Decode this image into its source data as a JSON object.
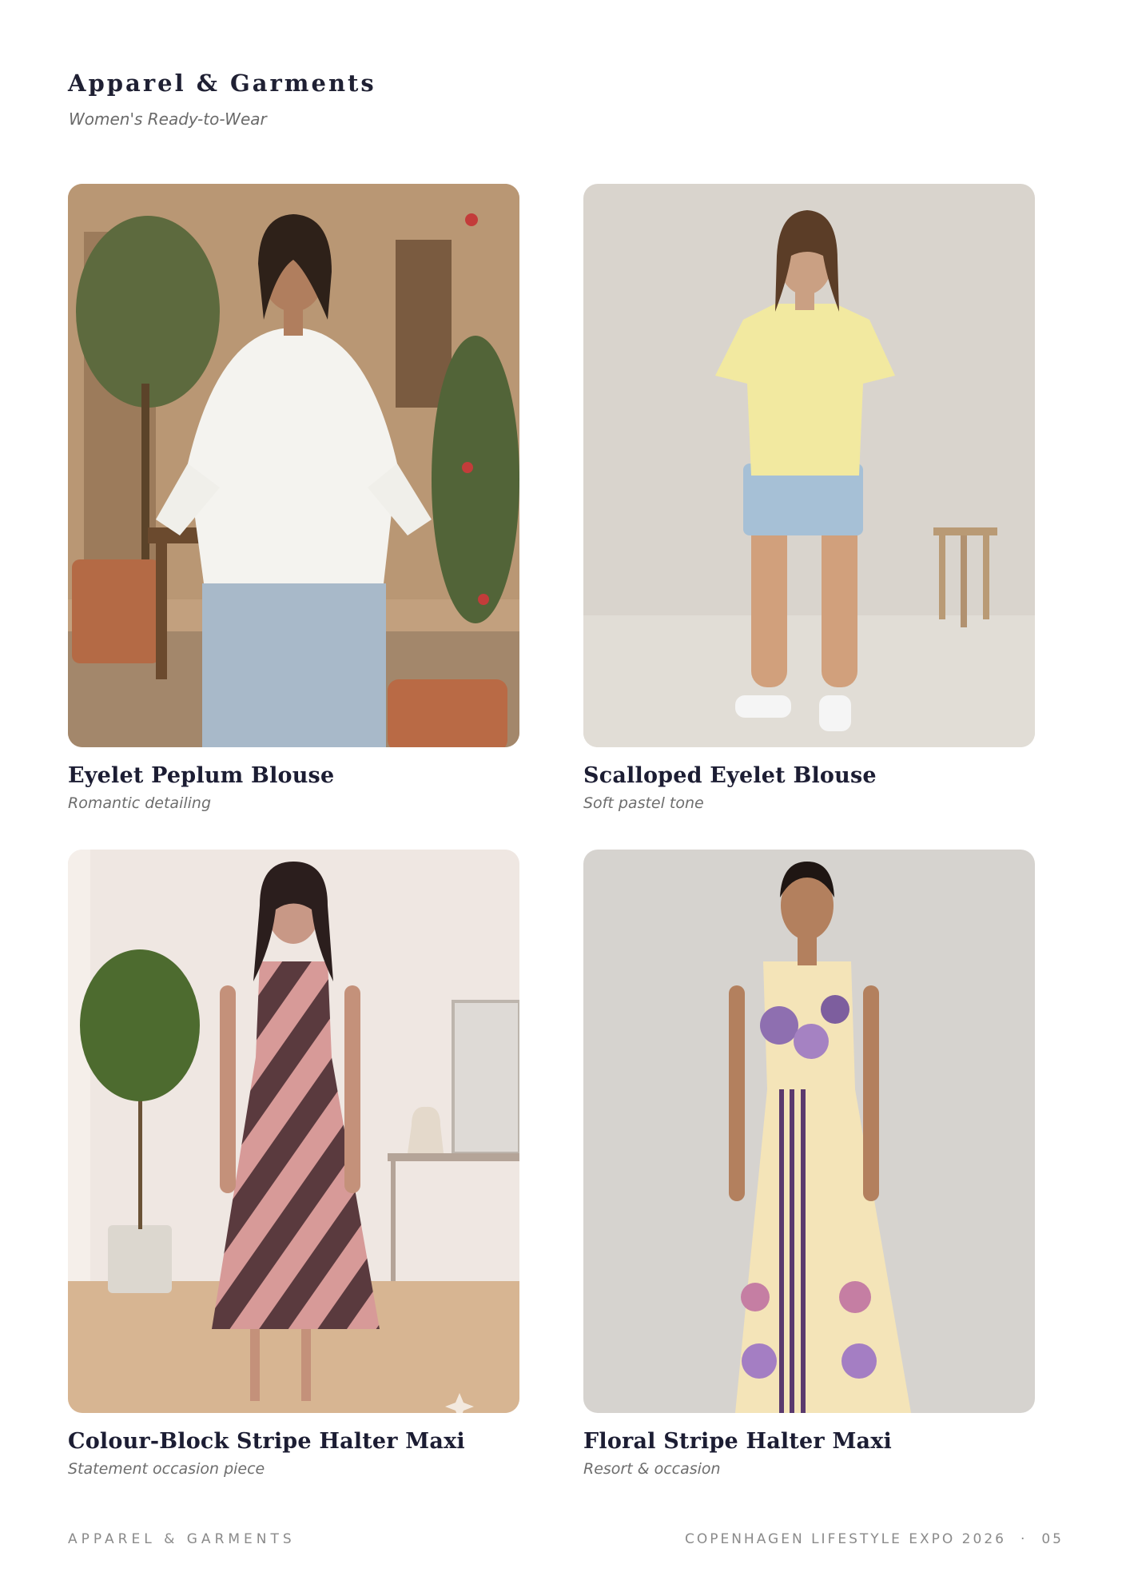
{
  "header": {
    "title": "Apparel & Garments",
    "subtitle": "Women's Ready-to-Wear"
  },
  "products": [
    {
      "name": "Eyelet Peplum Blouse",
      "tagline": "Romantic detailing"
    },
    {
      "name": "Scalloped Eyelet Blouse",
      "tagline": "Soft pastel tone"
    },
    {
      "name": "Colour-Block Stripe Halter Maxi",
      "tagline": "Statement occasion piece"
    },
    {
      "name": "Floral Stripe Halter Maxi",
      "tagline": "Resort & occasion"
    }
  ],
  "footer": {
    "section": "APPAREL & GARMENTS",
    "event": "COPENHAGEN LIFESTYLE EXPO 2026",
    "separator": "·",
    "page_number": "05"
  }
}
